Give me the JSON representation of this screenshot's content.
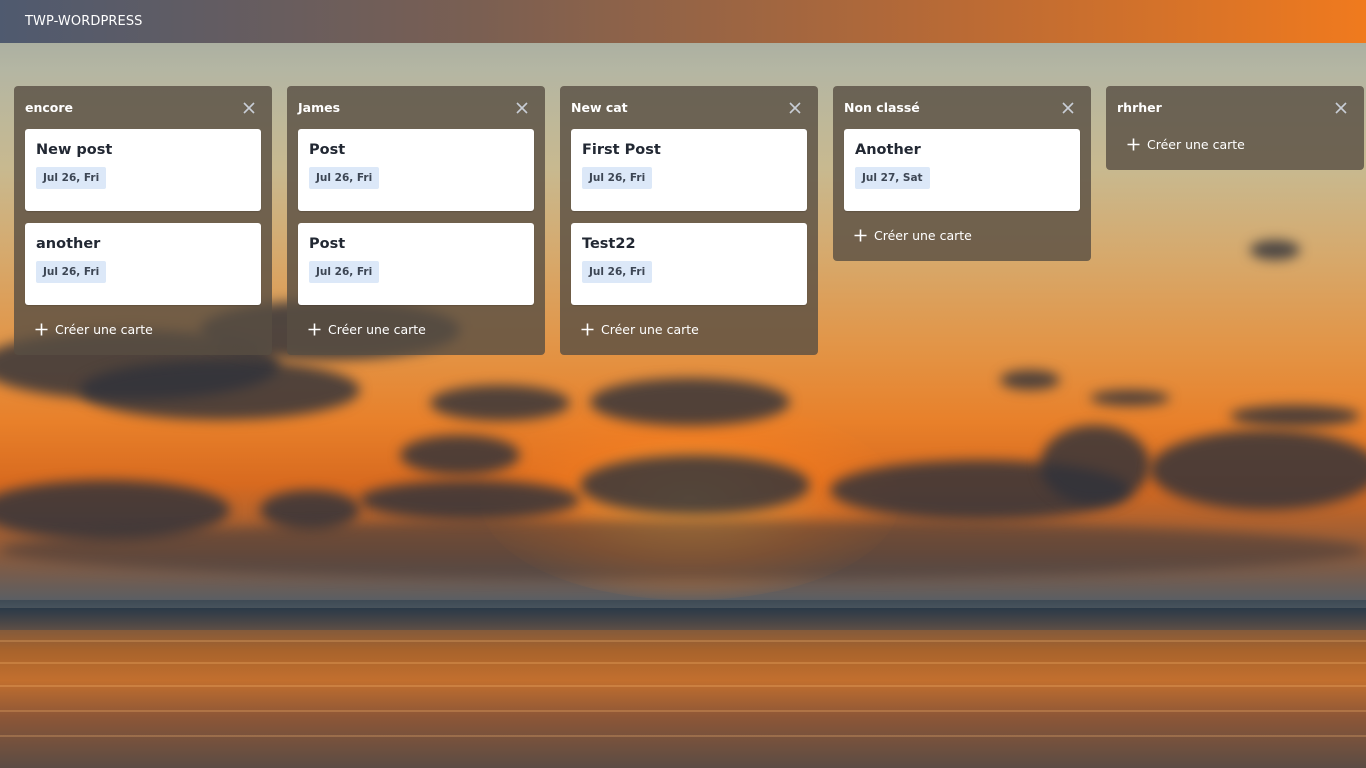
{
  "app": {
    "title": "TWP-WORDPRESS"
  },
  "colors": {
    "header_start": "#4f5a6f",
    "header_end": "#f07a1e",
    "badge_bg": "#dce8f8",
    "list_bg": "rgba(88,78,66,0.80)"
  },
  "icons": {
    "close": "close-icon",
    "add": "plus-icon"
  },
  "lists": [
    {
      "title": "encore",
      "cards": [
        {
          "title": "New post",
          "date": "Jul 26, Fri"
        },
        {
          "title": "another",
          "date": "Jul 26, Fri"
        }
      ],
      "add_label": "Créer une carte"
    },
    {
      "title": "James",
      "cards": [
        {
          "title": "Post",
          "date": "Jul 26, Fri"
        },
        {
          "title": "Post",
          "date": "Jul 26, Fri"
        }
      ],
      "add_label": "Créer une carte"
    },
    {
      "title": "New cat",
      "cards": [
        {
          "title": "First Post",
          "date": "Jul 26, Fri"
        },
        {
          "title": "Test22",
          "date": "Jul 26, Fri"
        }
      ],
      "add_label": "Créer une carte"
    },
    {
      "title": "Non classé",
      "cards": [
        {
          "title": "Another",
          "date": "Jul 27, Sat"
        }
      ],
      "add_label": "Créer une carte"
    },
    {
      "title": "rhrher",
      "cards": [],
      "add_label": "Créer une carte"
    }
  ]
}
